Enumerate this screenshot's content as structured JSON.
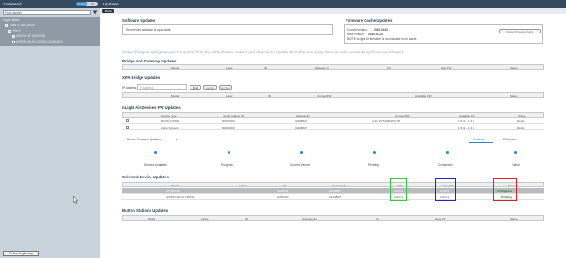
{
  "topbar": {
    "selection_count": "2 selected",
    "toggle_on": "Update",
    "toggle_off": "Clr",
    "page_title": "Updates"
  },
  "left": {
    "filter_placeholder": "Find devices",
    "tree": [
      "nLight Mixed",
      "1885 S 1650 (SEA)",
      "Port 4",
      "xPODM 4P (32003CB)",
      "xPODM 4D-DX 0D1FW (2120042C)"
    ],
    "new_gateway_button": "Find new gateway"
  },
  "toolbar": {
    "back_button": "Back"
  },
  "software": {
    "heading": "Software Updates",
    "status": "SensorView software is up-to-date"
  },
  "firmware_cache": {
    "heading": "Firmware Cache Updates",
    "current_label": "Current version:",
    "current_version": "2020.02.13",
    "new_label": "New version:",
    "new_version": "2020.03.13",
    "note": "NOTE: nLight Air firmware is not included in the cache.",
    "button": "Update Firmware Cache"
  },
  "intro_text": "Select bridges and gateways to update from the table below. Select and devices to update from the tree (only devices with available updates are shown).",
  "bridge_gateway": {
    "heading": "Bridge and Gateway Updates",
    "columns": [
      "Model",
      "Label",
      "ID",
      "Gateway ID",
      "S/I",
      "New FW",
      "Status"
    ]
  },
  "xpa": {
    "heading": "XPA Bridge Updates",
    "ip_label": "IP Address",
    "ip_placeholder": "IP Address",
    "buttons": [
      "Find",
      "Get Ver",
      "Get Sect"
    ],
    "columns": [
      "Model",
      "Label",
      "ID",
      "Current FW",
      "Available FW",
      "Status"
    ]
  },
  "nlight_air": {
    "heading": "nLight Air Devices FW Updates",
    "columns": [
      "Device Type",
      "nLight Adaptor ID",
      "Gateway ID",
      "Current FW",
      "Available FW",
      "Status"
    ],
    "rows": [
      [
        "rBCVD 9LTWR",
        "90002D04",
        "01448827",
        "2.4.1.16*64996467F7D",
        "1.5.41 - 1.3.4",
        "Ready"
      ],
      [
        "Entire Network",
        "90002D04",
        "01448827",
        "-",
        "1.5.41 - 1.3.4",
        "Ready"
      ]
    ],
    "select_label": "Device Firmware Updates",
    "tabs": [
      "Summary",
      "All Devices"
    ],
    "progress_labels": [
      "Devices Available",
      "Progress",
      "Current Version",
      "Pending",
      "Completed",
      "Failed"
    ]
  },
  "selected": {
    "heading": "Selected Device Updates",
    "columns": [
      "Model",
      "Label",
      "ID",
      "Gateway ID",
      "FW",
      "New FW",
      "Status"
    ],
    "rows": [
      [
        "xPODM 4P",
        "",
        "32003CB",
        "01448827",
        "2.023.4",
        "2.026.4",
        "In Progress"
      ],
      [
        "xPODM 4D-DX 0D1FW",
        "",
        "2120042C",
        "01448827",
        "2.023.4",
        "2.023.4",
        "Pending"
      ]
    ],
    "highlight_colors": {
      "fw": "#2ecc40",
      "new_fw": "#2222cc",
      "status": "#e02020"
    }
  },
  "button_stations": {
    "heading": "Button Stations Updates",
    "columns": [
      "Model",
      "Label",
      "ID",
      "Gateway ID",
      "S/I",
      "New FW",
      "Status"
    ]
  }
}
